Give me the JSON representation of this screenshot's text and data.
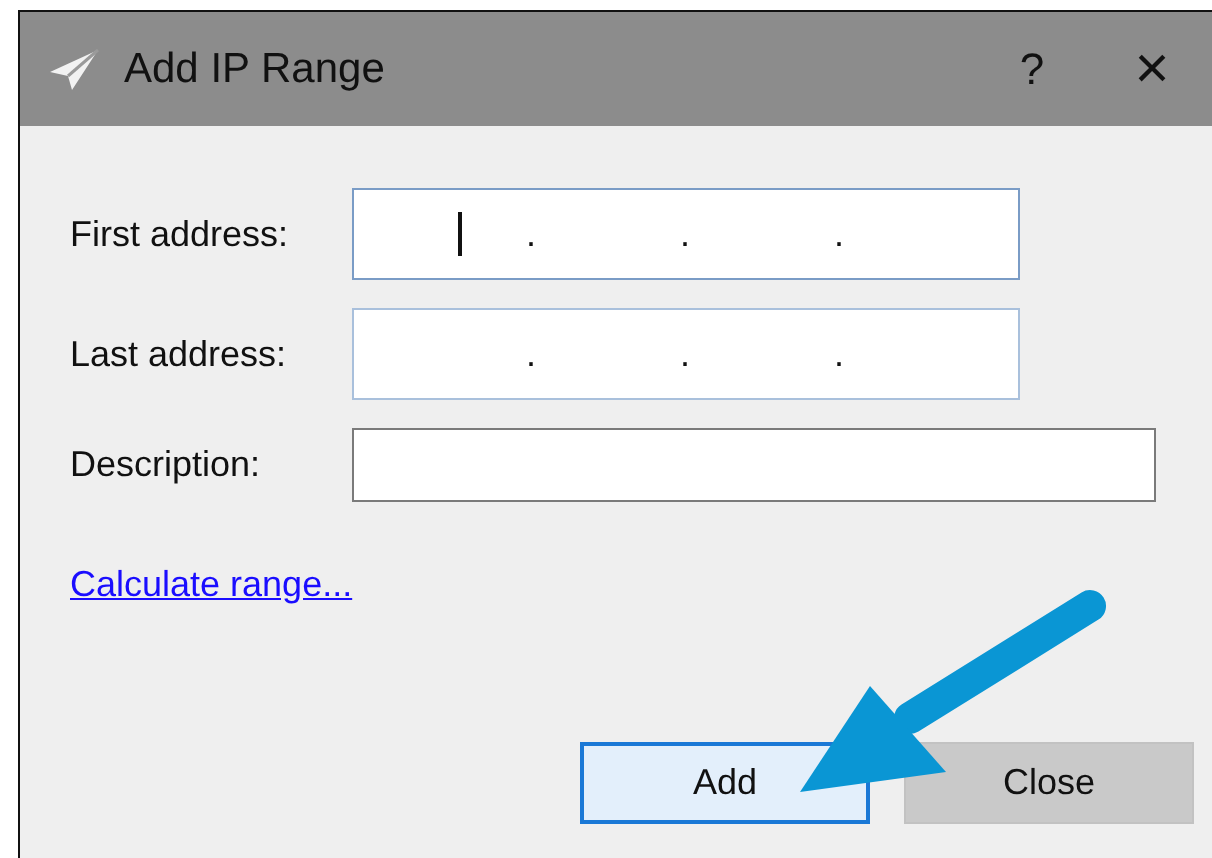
{
  "window": {
    "title": "Add IP Range",
    "help": "?",
    "close": "×"
  },
  "fields": [
    {
      "kind": "ip",
      "label": "First address:",
      "focused": true,
      "dots": [
        ".",
        ".",
        "."
      ]
    },
    {
      "kind": "ip",
      "label": "Last address:",
      "focused": false,
      "dots": [
        ".",
        ".",
        "."
      ]
    },
    {
      "kind": "text",
      "label": "Description:",
      "focused": false
    }
  ],
  "link": "Calculate range...",
  "buttons": [
    {
      "label": "Add",
      "default": true
    },
    {
      "label": "Close",
      "default": false
    }
  ]
}
